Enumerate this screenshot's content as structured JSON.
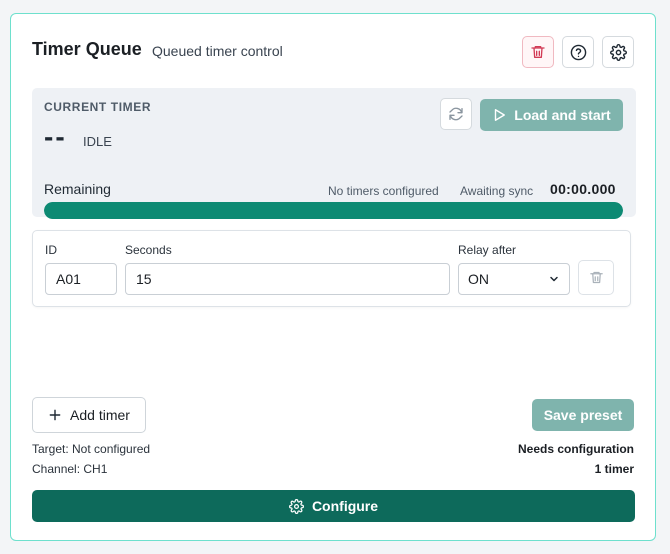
{
  "header": {
    "title": "Timer Queue",
    "subtitle": "Queued timer control"
  },
  "header_actions": {
    "delete_icon": "trash-icon",
    "help_icon": "help-circle-icon",
    "settings_icon": "gear-icon"
  },
  "current_timer": {
    "label": "CURRENT TIMER",
    "value": "--",
    "state": "IDLE",
    "load_button_label": "Load and start",
    "remaining_label": "Remaining",
    "queue_status": "No timers configured",
    "sync_status": "Awaiting sync",
    "time_remaining": "00:00.000",
    "progress_fraction": 1.0
  },
  "timer_row": {
    "id_label": "ID",
    "id_value": "A01",
    "seconds_label": "Seconds",
    "seconds_value": "15",
    "relay_label": "Relay after",
    "relay_value": "ON",
    "relay_options": [
      "ON"
    ]
  },
  "footer": {
    "add_button_label": "Add timer",
    "save_button_label": "Save preset",
    "target_text": "Target: Not configured",
    "channel_text": "Channel: CH1",
    "status_text": "Needs configuration",
    "count_text": "1 timer",
    "configure_button_label": "Configure"
  },
  "colors": {
    "accent": "#0d6a5b",
    "progress": "#0d8a73",
    "disabled_button": "#7fb4ad",
    "card_border": "#6ee0cd",
    "danger": "#d23a55"
  }
}
